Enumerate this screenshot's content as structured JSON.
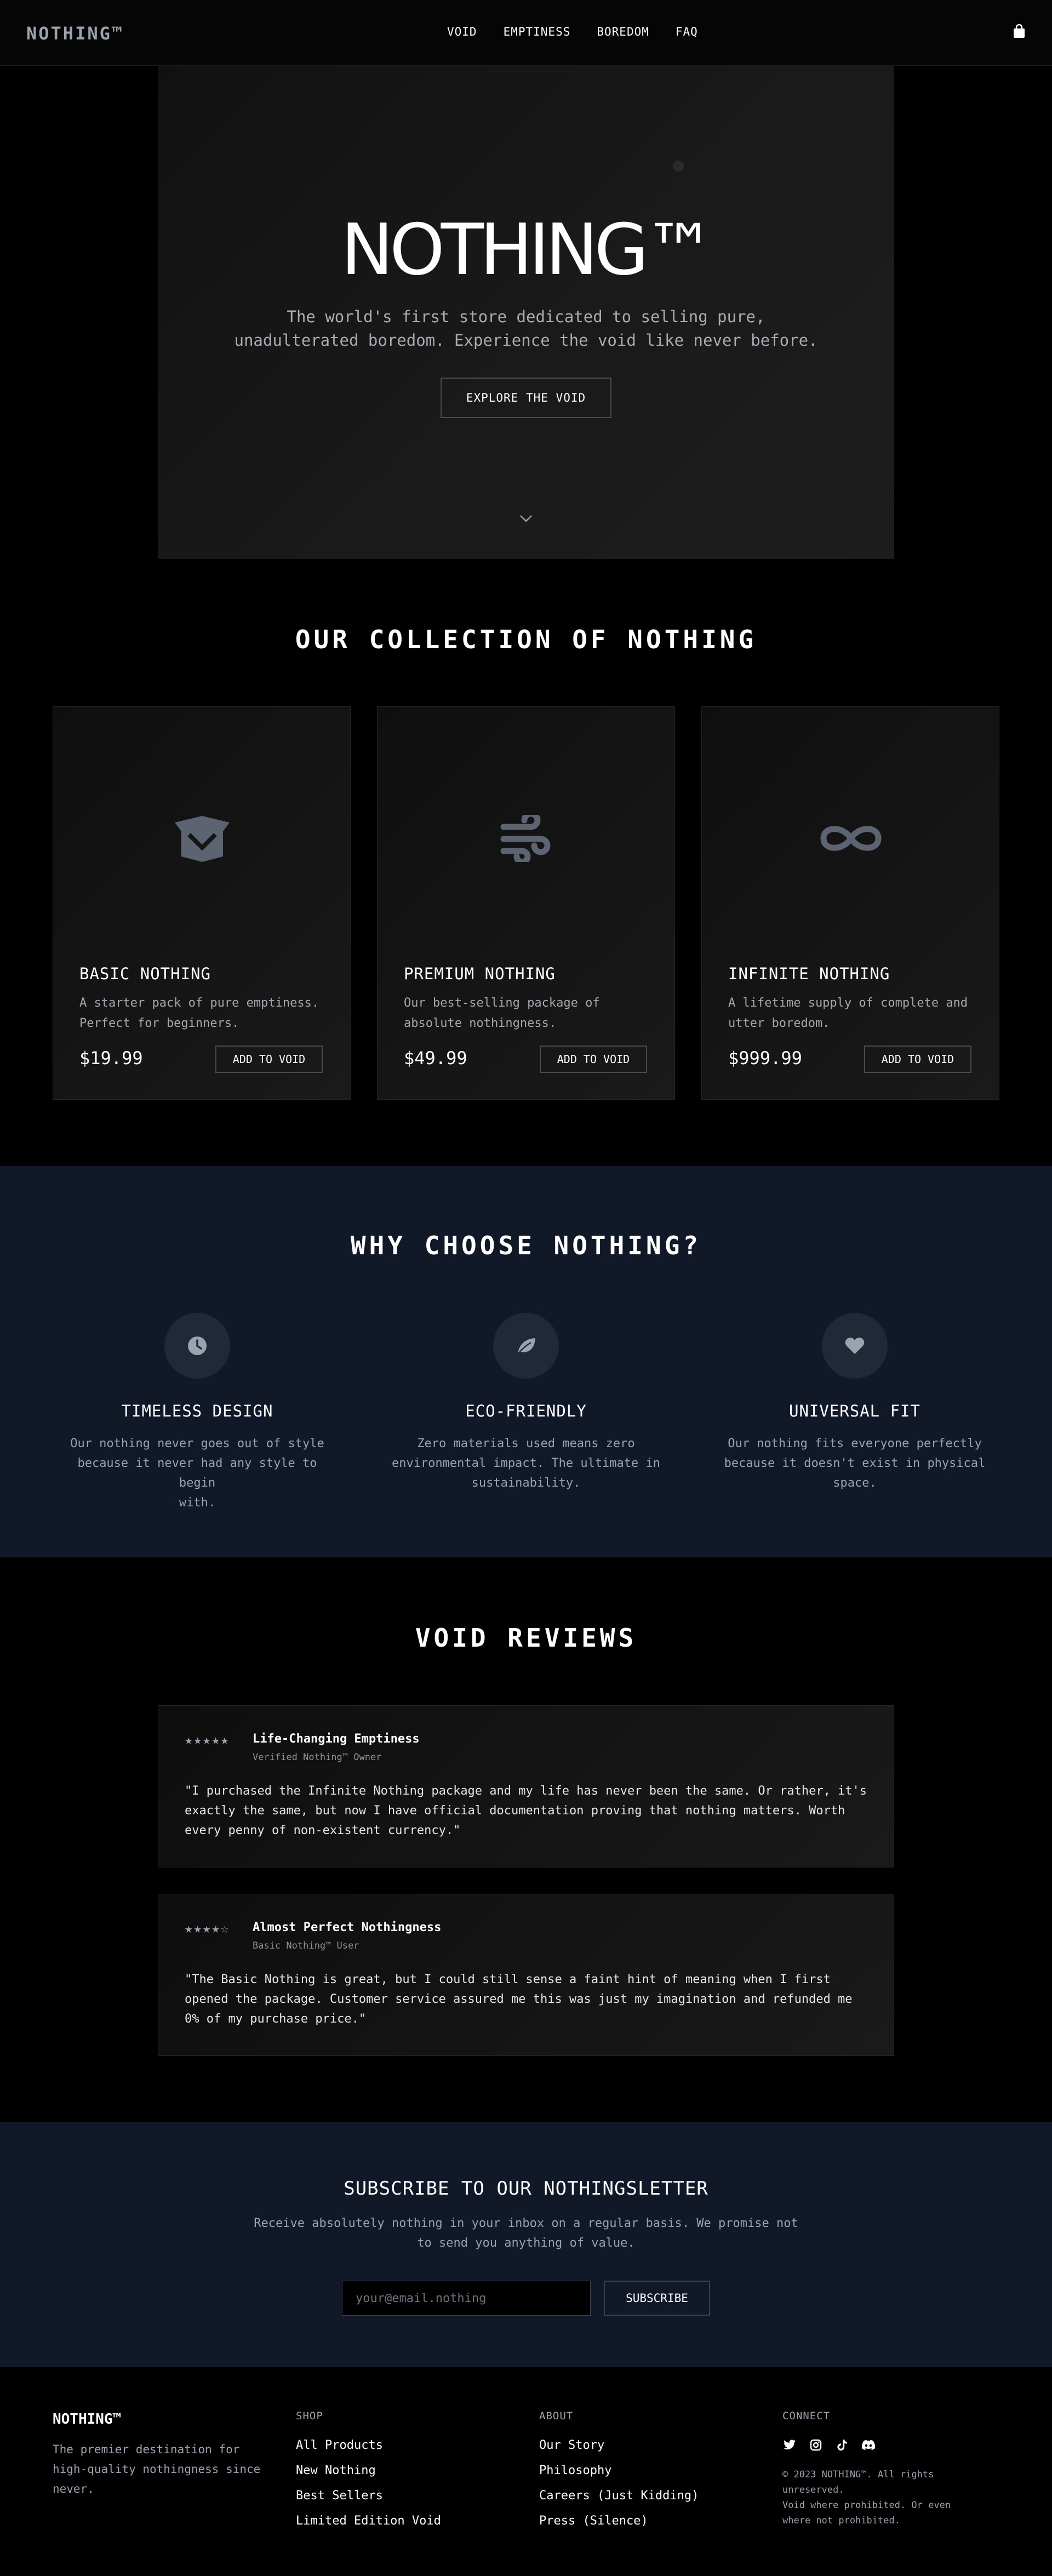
{
  "nav": {
    "brand": "NOTHING™",
    "links": [
      "VOID",
      "EMPTINESS",
      "BOREDOM",
      "FAQ"
    ],
    "cart_icon": "shopping-bag-icon"
  },
  "hero": {
    "title": "NOTHING™",
    "subtitle_line1": "The world's first store dedicated to selling pure,",
    "subtitle_line2": "unadulterated boredom. Experience the void like never before.",
    "cta": "EXPLORE THE VOID"
  },
  "collection": {
    "title": "OUR COLLECTION OF NOTHING",
    "products": [
      {
        "name": "BASIC NOTHING",
        "desc_line1": "A starter pack of pure emptiness.",
        "desc_line2": "Perfect for beginners.",
        "price": "$19.99",
        "button": "ADD TO VOID",
        "icon": "open-box-icon"
      },
      {
        "name": "PREMIUM NOTHING",
        "desc_line1": "Our best-selling package of",
        "desc_line2": "absolute nothingness.",
        "price": "$49.99",
        "button": "ADD TO VOID",
        "icon": "wind-icon"
      },
      {
        "name": "INFINITE NOTHING",
        "desc_line1": "A lifetime supply of complete and",
        "desc_line2": "utter boredom.",
        "price": "$999.99",
        "button": "ADD TO VOID",
        "icon": "infinity-icon"
      }
    ]
  },
  "why": {
    "title": "WHY CHOOSE NOTHING?",
    "features": [
      {
        "title": "TIMELESS DESIGN",
        "line1": "Our nothing never goes out of style",
        "line2": "because it never had any style to begin",
        "line3": "with.",
        "icon": "clock-icon"
      },
      {
        "title": "ECO-FRIENDLY",
        "line1": "Zero materials used means zero",
        "line2": "environmental impact. The ultimate in",
        "line3": "sustainability.",
        "icon": "leaf-icon"
      },
      {
        "title": "UNIVERSAL FIT",
        "line1": "Our nothing fits everyone perfectly",
        "line2": "because it doesn't exist in physical",
        "line3": "space.",
        "icon": "heart-icon"
      }
    ]
  },
  "reviews": {
    "title": "VOID REVIEWS",
    "items": [
      {
        "stars": "★★★★★",
        "rating": 5,
        "title": "Life-Changing Emptiness",
        "role": "Verified Nothing™ Owner",
        "line1": "\"I purchased the Infinite Nothing package and my life has never been the same. Or rather, it's",
        "line2": "exactly the same, but now I have official documentation proving that nothing matters. Worth",
        "line3": "every penny of non-existent currency.\""
      },
      {
        "stars": "★★★★☆",
        "rating": 4,
        "title": "Almost Perfect Nothingness",
        "role": "Basic Nothing™ User",
        "line1": "\"The Basic Nothing is great, but I could still sense a faint hint of meaning when I first",
        "line2": "opened the package. Customer service assured me this was just my imagination and refunded me",
        "line3": "0% of my purchase price.\""
      }
    ]
  },
  "newsletter": {
    "title": "SUBSCRIBE TO OUR NOTHINGSLETTER",
    "line1": "Receive absolutely nothing in your inbox on a regular basis. We promise not",
    "line2": "to send you anything of value.",
    "placeholder": "your@email.nothing",
    "button": "SUBSCRIBE"
  },
  "footer": {
    "brand": "NOTHING™",
    "tagline_line1": "The premier destination for",
    "tagline_line2": "high-quality nothingness since",
    "tagline_line3": "never.",
    "shop": {
      "heading": "SHOP",
      "links": [
        "All Products",
        "New Nothing",
        "Best Sellers",
        "Limited Edition Void"
      ]
    },
    "about": {
      "heading": "ABOUT",
      "links": [
        "Our Story",
        "Philosophy",
        "Careers (Just Kidding)",
        "Press (Silence)"
      ]
    },
    "connect": {
      "heading": "CONNECT",
      "socials": [
        "twitter-icon",
        "instagram-icon",
        "tiktok-icon",
        "discord-icon"
      ],
      "copy_line1": "© 2023 NOTHING™. All rights",
      "copy_line2": "unreserved.",
      "copy_line3": "Void where prohibited. Or even",
      "copy_line4": "where not prohibited."
    }
  },
  "colors": {
    "background": "#000000",
    "panel": "#111827",
    "accent_gray": "#9ca3af",
    "card": "#151515"
  }
}
